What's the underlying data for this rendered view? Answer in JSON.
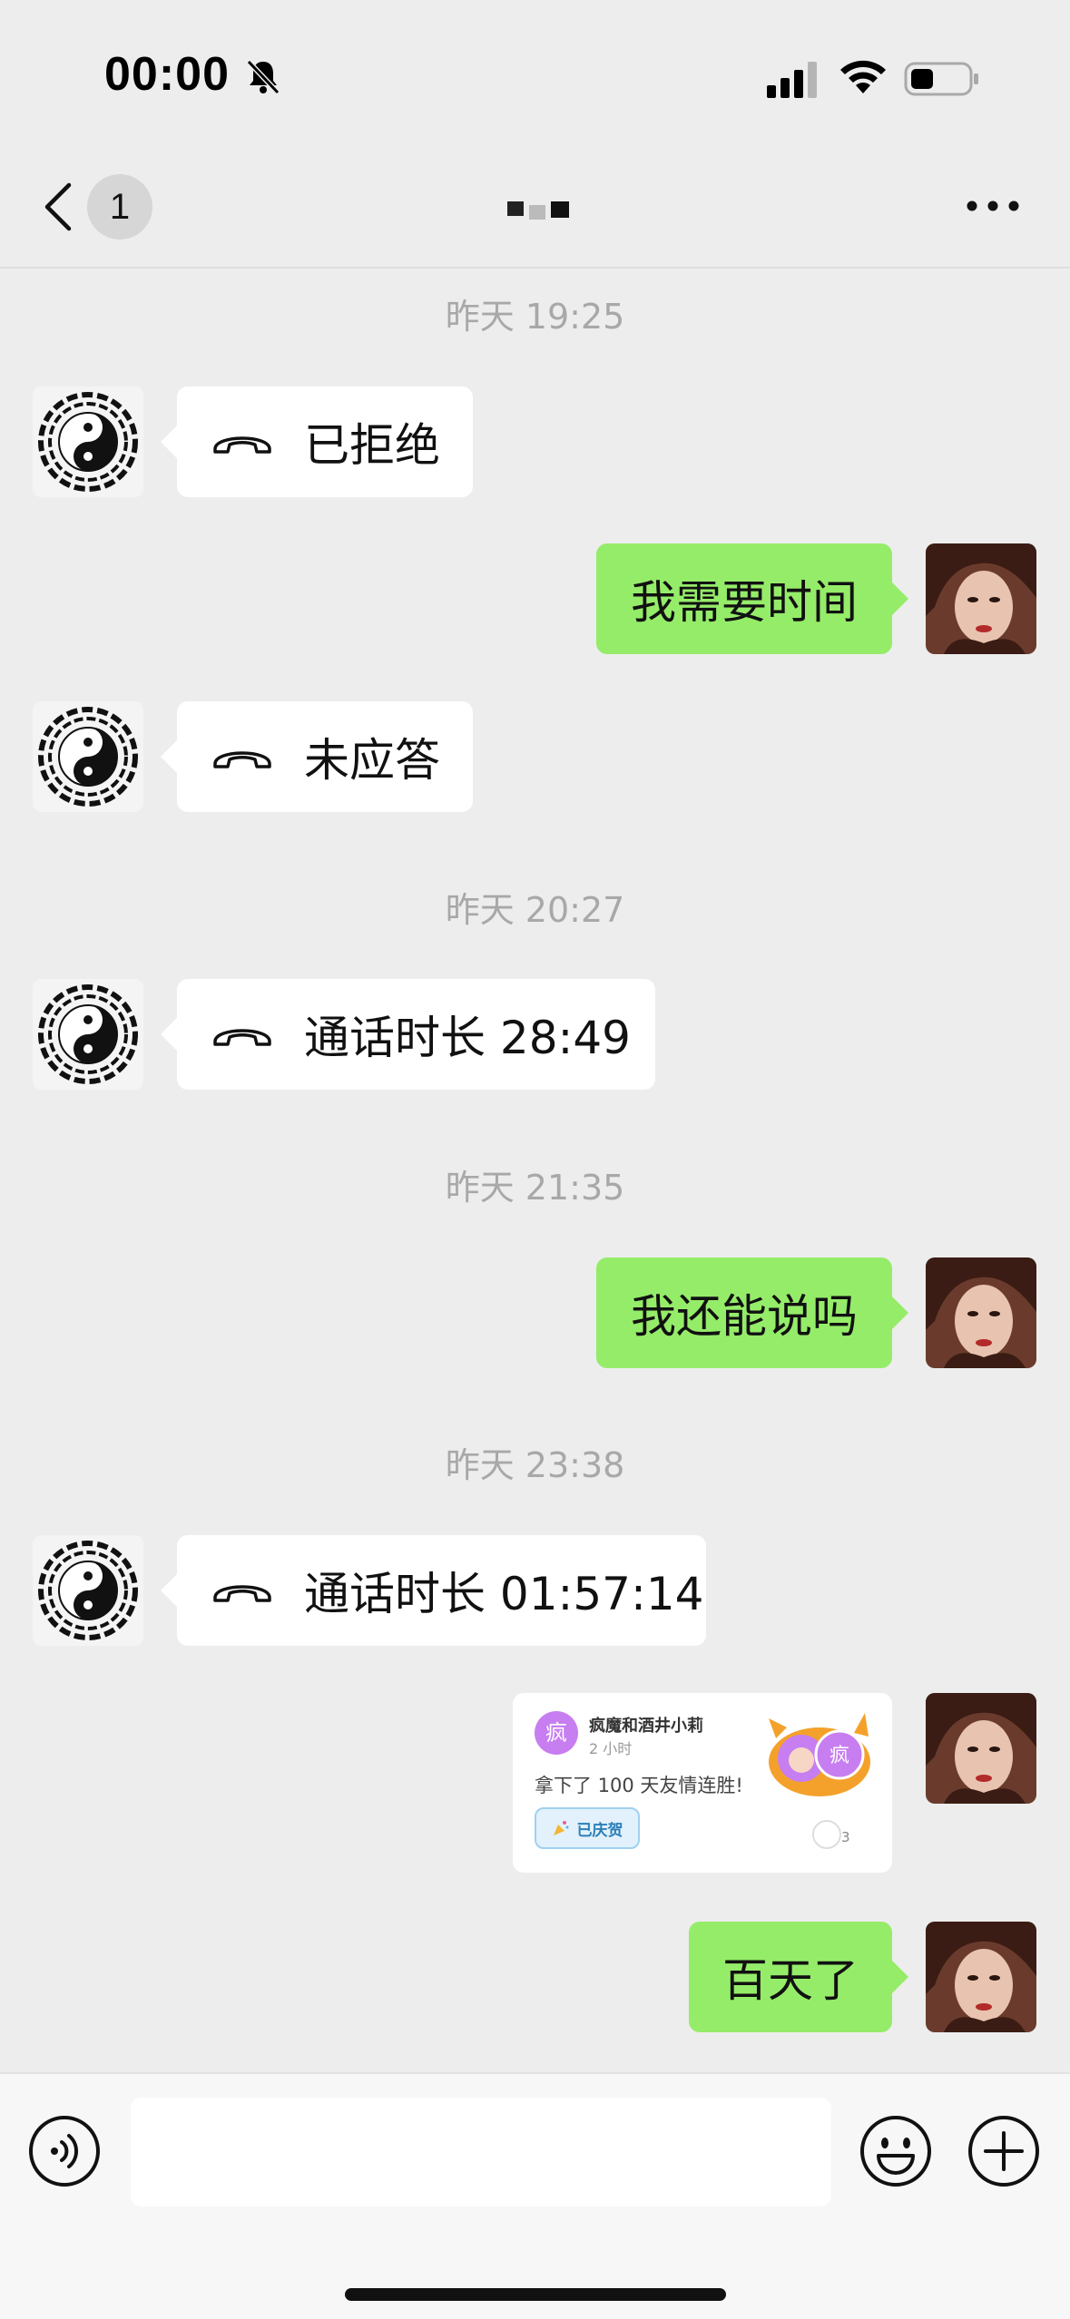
{
  "status_bar": {
    "time": "00:00",
    "icons": [
      "bell-mute-icon",
      "signal-icon",
      "wifi-icon",
      "battery-icon"
    ]
  },
  "nav": {
    "unread_count": "1",
    "icons": [
      "back-icon",
      "more-icon"
    ]
  },
  "messages": [
    {
      "type": "timestamp",
      "text": "昨天 19:25"
    },
    {
      "type": "call",
      "side": "left",
      "text": "已拒绝"
    },
    {
      "type": "text",
      "side": "right",
      "text": "我需要时间"
    },
    {
      "type": "call",
      "side": "left",
      "text": "未应答"
    },
    {
      "type": "timestamp",
      "text": "昨天 20:27"
    },
    {
      "type": "call",
      "side": "left",
      "text": "通话时长 28:49"
    },
    {
      "type": "timestamp",
      "text": "昨天 21:35"
    },
    {
      "type": "text",
      "side": "right",
      "text": "我还能说吗"
    },
    {
      "type": "timestamp",
      "text": "昨天 23:38"
    },
    {
      "type": "call",
      "side": "left",
      "text": "通话时长 01:57:14"
    },
    {
      "type": "card",
      "side": "right"
    },
    {
      "type": "text",
      "side": "right",
      "text": "百天了"
    }
  ],
  "card": {
    "avatar_char": "疯",
    "title": "疯魔和酒井小莉",
    "subtitle": "2 小时",
    "main_text": "拿下了 100 天友情连胜!",
    "chip_label": "已庆贺",
    "badge_char": "疯",
    "count": "3"
  },
  "input_bar": {
    "placeholder": "",
    "icons": [
      "voice-icon",
      "emoji-icon",
      "plus-icon"
    ]
  },
  "colors": {
    "background": "#ededed",
    "sent_bubble": "#95ec69",
    "received_bubble": "#ffffff",
    "timestamp": "#a8a8a8"
  }
}
